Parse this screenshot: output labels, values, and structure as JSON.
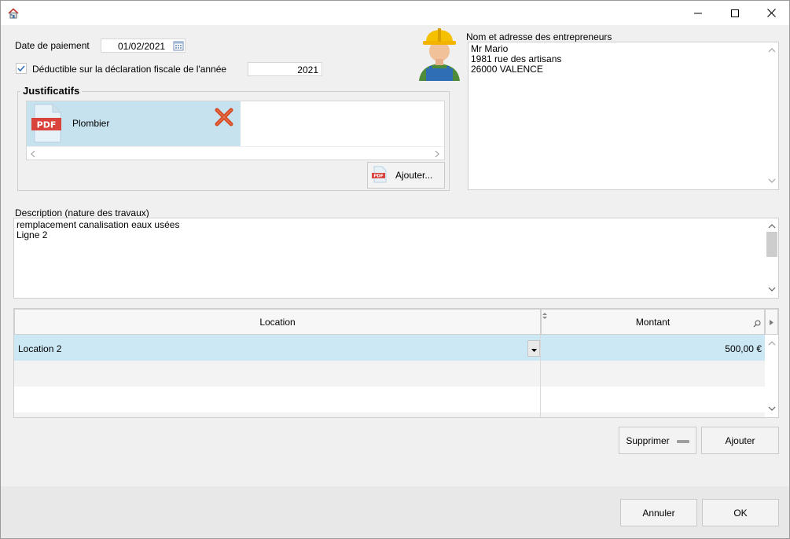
{
  "window": {
    "title": "",
    "icons": {
      "app": "house-icon",
      "minimize": "minimize-icon",
      "maximize": "maximize-icon",
      "close": "close-icon"
    }
  },
  "payment": {
    "date_label": "Date de paiement",
    "date_value": "01/02/2021",
    "deductible_label": "Déductible sur la déclaration fiscale de l'année",
    "deductible_checked": true,
    "year_value": "2021"
  },
  "justificatifs": {
    "legend": "Justificatifs",
    "files": [
      {
        "name": "Plombier",
        "icon": "pdf-file-icon"
      }
    ],
    "add_button": "Ajouter..."
  },
  "contractor": {
    "label": "Nom et adresse des entrepreneurs",
    "avatar": "construction-worker-icon",
    "lines": [
      "Mr Mario",
      "1981 rue des artisans",
      "26000 VALENCE"
    ]
  },
  "description": {
    "label": "Description (nature des travaux)",
    "lines": [
      "remplacement canalisation eaux usées",
      "Ligne 2"
    ]
  },
  "grid": {
    "columns": [
      "Location",
      "Montant"
    ],
    "rows": [
      {
        "location": "Location 2",
        "amount": "500,00 €"
      }
    ]
  },
  "grid_actions": {
    "delete": "Supprimer",
    "add": "Ajouter"
  },
  "footer": {
    "cancel": "Annuler",
    "ok": "OK"
  },
  "colors": {
    "selection": "#cce8f4",
    "pdf_red": "#d9433b",
    "delete_red": "#d34a22"
  }
}
